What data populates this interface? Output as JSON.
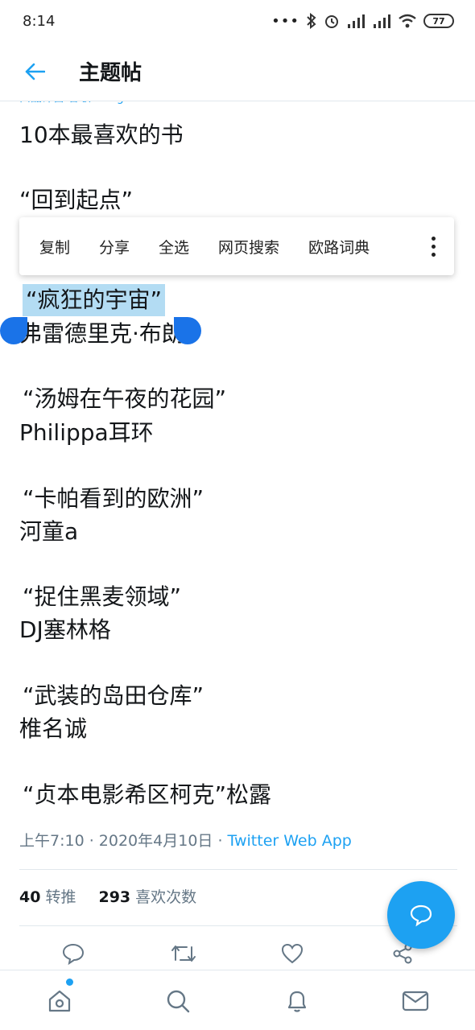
{
  "status_bar": {
    "time": "8:14",
    "battery": "77"
  },
  "header": {
    "title": "主题帖"
  },
  "translate_fragment": "由翻译自 谷歌 Google",
  "tweet": {
    "title": "10本最喜欢的书",
    "books": [
      {
        "title": "“回到起点”",
        "author": ""
      },
      {
        "title": "“疯狂的宇宙”",
        "author": "弗雷德里克·布朗"
      },
      {
        "title": "“汤姆在午夜的花园”",
        "author": " Philippa耳环"
      },
      {
        "title": "“卡帕看到的欧洲”",
        "author": "河童a"
      },
      {
        "title": "“捉住黑麦领域”",
        "author": " DJ塞林格"
      },
      {
        "title": "“武装的岛田仓库”",
        "author": "椎名诚"
      },
      {
        "title": "“贞本电影希区柯克”松露",
        "author": ""
      }
    ],
    "meta_time": "上午7:10 · 2020年4月10日 · ",
    "meta_source": "Twitter Web App",
    "retweets": "40",
    "retweets_label": "转推",
    "likes": "293",
    "likes_label": "喜欢次数"
  },
  "context_menu": {
    "items": [
      "复制",
      "分享",
      "全选",
      "网页搜索",
      "欧路词典"
    ]
  },
  "selection_color": "#b3dcf3",
  "accent_color": "#1da1f2"
}
